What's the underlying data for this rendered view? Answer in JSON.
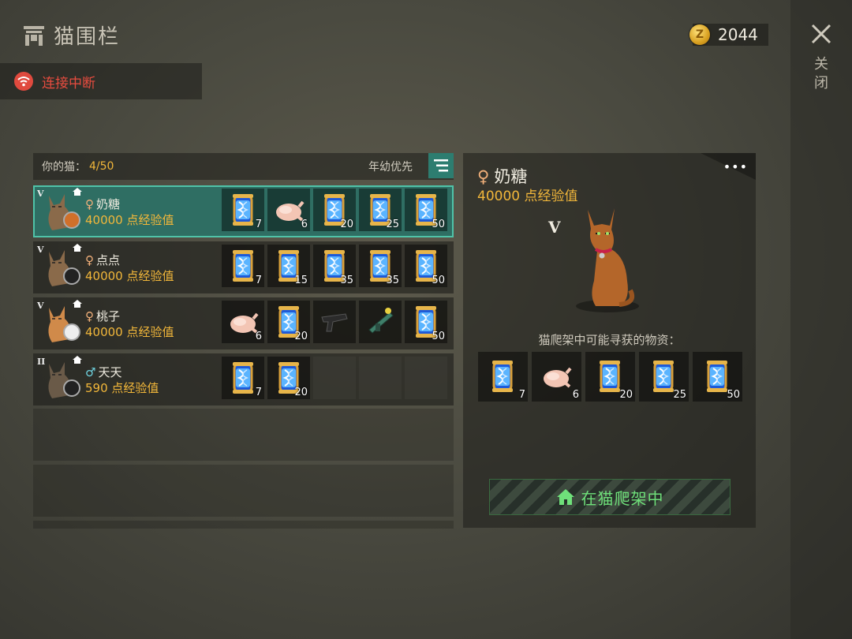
{
  "header": {
    "title": "猫围栏",
    "coins": "2044",
    "close_label": "关闭"
  },
  "connection": {
    "status": "连接中断"
  },
  "list": {
    "your_cats_label": "你的猫：",
    "count": "4/50",
    "sort_label": "年幼优先",
    "rows": [
      {
        "rank": "V",
        "sex": "♀",
        "name": "奶糖",
        "xp": "40000 点经验值",
        "items": [
          {
            "type": "dna",
            "qty": "7"
          },
          {
            "type": "chicken",
            "qty": "6"
          },
          {
            "type": "dna",
            "qty": "20"
          },
          {
            "type": "dna",
            "qty": "25"
          },
          {
            "type": "dna",
            "qty": "50"
          }
        ]
      },
      {
        "rank": "V",
        "sex": "♀",
        "name": "点点",
        "xp": "40000 点经验值",
        "items": [
          {
            "type": "dna",
            "qty": "7"
          },
          {
            "type": "dna",
            "qty": "15"
          },
          {
            "type": "dna",
            "qty": "35"
          },
          {
            "type": "dna",
            "qty": "35"
          },
          {
            "type": "dna",
            "qty": "50"
          }
        ]
      },
      {
        "rank": "V",
        "sex": "♀",
        "name": "桃子",
        "xp": "40000 点经验值",
        "items": [
          {
            "type": "chicken",
            "qty": "6"
          },
          {
            "type": "dna",
            "qty": "20"
          },
          {
            "type": "smg",
            "qty": ""
          },
          {
            "type": "launcher",
            "qty": ""
          },
          {
            "type": "dna",
            "qty": "50"
          }
        ]
      },
      {
        "rank": "II",
        "sex": "♂",
        "name": "天天",
        "xp": "590 点经验值",
        "items": [
          {
            "type": "dna",
            "qty": "7"
          },
          {
            "type": "dna",
            "qty": "20"
          }
        ]
      }
    ]
  },
  "detail": {
    "sex": "♀",
    "name": "奶糖",
    "xp": "40000 点经验值",
    "rank": "V",
    "find_label": "猫爬架中可能寻获的物资：",
    "items": [
      {
        "type": "dna",
        "qty": "7"
      },
      {
        "type": "chicken",
        "qty": "6"
      },
      {
        "type": "dna",
        "qty": "20"
      },
      {
        "type": "dna",
        "qty": "25"
      },
      {
        "type": "dna",
        "qty": "50"
      }
    ],
    "status_label": "在猫爬架中"
  },
  "colors": {
    "accent": "#2d7d70",
    "gold": "#f2b73a",
    "alert": "#e84c3f",
    "green": "#6fe07a"
  }
}
